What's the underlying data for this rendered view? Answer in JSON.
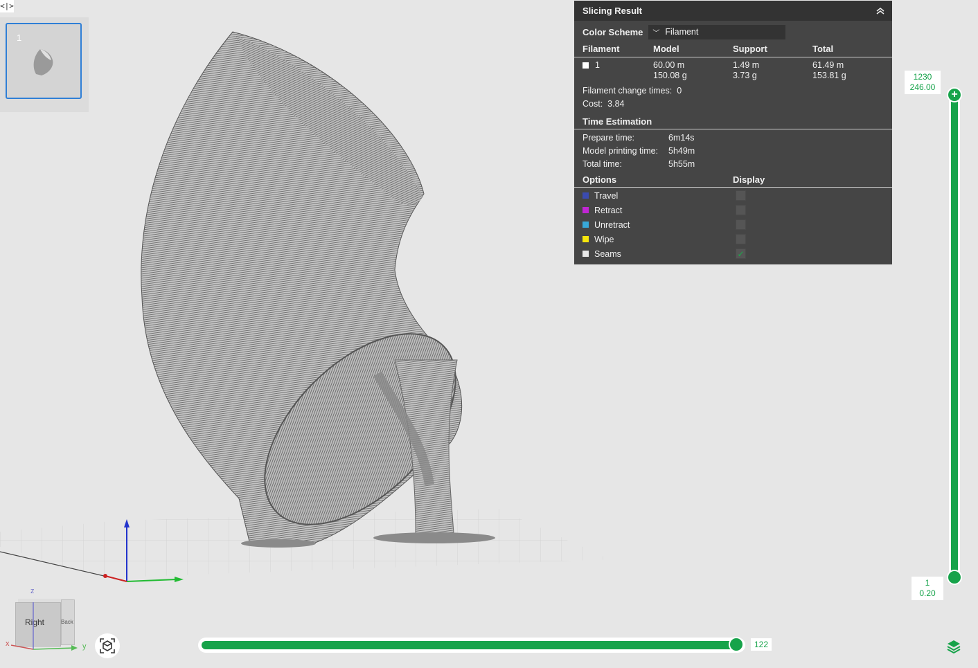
{
  "sidebar": {
    "collapse_icon": "code-brackets-icon",
    "plate_index": "1"
  },
  "slicing_result": {
    "title": "Slicing Result",
    "collapse_icon": "chevron-double-up-icon",
    "color_scheme_label": "Color Scheme",
    "color_scheme_value": "Filament",
    "columns": [
      "Filament",
      "Model",
      "Support",
      "Total"
    ],
    "filament_rows": [
      {
        "id": "1",
        "color": "#ffffff",
        "model_length": "60.00 m",
        "model_weight": "150.08 g",
        "support_length": "1.49 m",
        "support_weight": "3.73 g",
        "total_length": "61.49 m",
        "total_weight": "153.81 g"
      }
    ],
    "filament_change_label": "Filament change times:",
    "filament_change_value": "0",
    "cost_label": "Cost:",
    "cost_value": "3.84",
    "time_heading": "Time Estimation",
    "times": [
      {
        "label": "Prepare time:",
        "value": "6m14s"
      },
      {
        "label": "Model printing time:",
        "value": "5h49m"
      },
      {
        "label": "Total time:",
        "value": "5h55m"
      }
    ],
    "options_heading": "Options",
    "display_heading": "Display",
    "options": [
      {
        "label": "Travel",
        "color": "#3b4bb0",
        "checked": false
      },
      {
        "label": "Retract",
        "color": "#c026d3",
        "checked": false
      },
      {
        "label": "Unretract",
        "color": "#38a8d8",
        "checked": false
      },
      {
        "label": "Wipe",
        "color": "#f5e50c",
        "checked": false
      },
      {
        "label": "Seams",
        "color": "#e8e8e8",
        "checked": true
      }
    ]
  },
  "layer_slider": {
    "top_layer": "1230",
    "top_height": "246.00",
    "bottom_layer": "1",
    "bottom_height": "0.20",
    "accent": "#16a34a"
  },
  "move_slider": {
    "value": "122"
  },
  "nav_cube": {
    "face_label": "Right",
    "side_label": "Back",
    "axis_x": "x",
    "axis_y": "y",
    "axis_z": "z"
  },
  "colors": {
    "panel_bg": "#454545",
    "accent": "#16a34a",
    "selection": "#2f7fd6"
  }
}
